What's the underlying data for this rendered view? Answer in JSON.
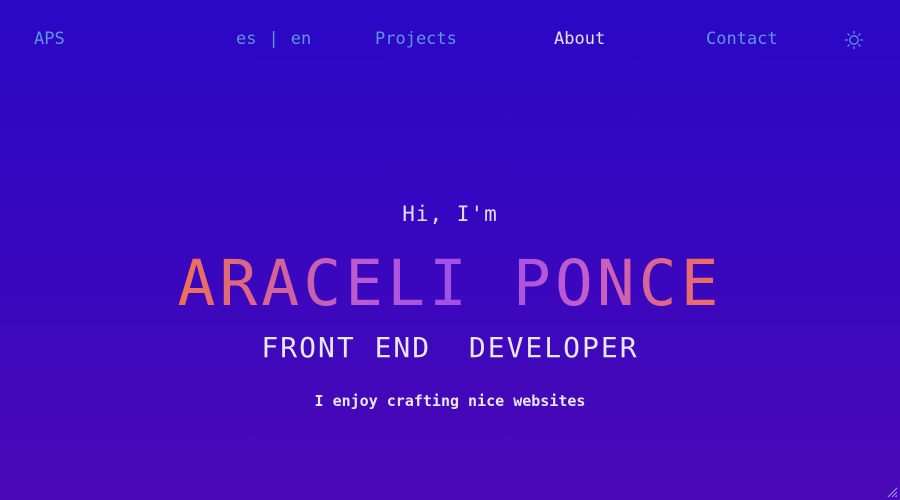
{
  "nav": {
    "logo": "APS",
    "lang": {
      "es": "es",
      "separator": "|",
      "en": "en"
    },
    "links": {
      "projects": "Projects",
      "about": "About",
      "contact": "Contact"
    },
    "active": "about",
    "theme_icon": "sun-icon"
  },
  "hero": {
    "greeting": "Hi, I'm",
    "name": "ARACELI PONCE",
    "role": "FRONT END  DEVELOPER",
    "tagline": "I enjoy crafting nice websites"
  },
  "colors": {
    "background_top": "#2a08c6",
    "background_bottom": "#4a09b6",
    "nav_link": "#5f93ea",
    "nav_active": "#e6e2ff",
    "name_gradient_start": "#f07055",
    "name_gradient_mid": "#9850ea",
    "text_light": "#e9e6ff"
  }
}
